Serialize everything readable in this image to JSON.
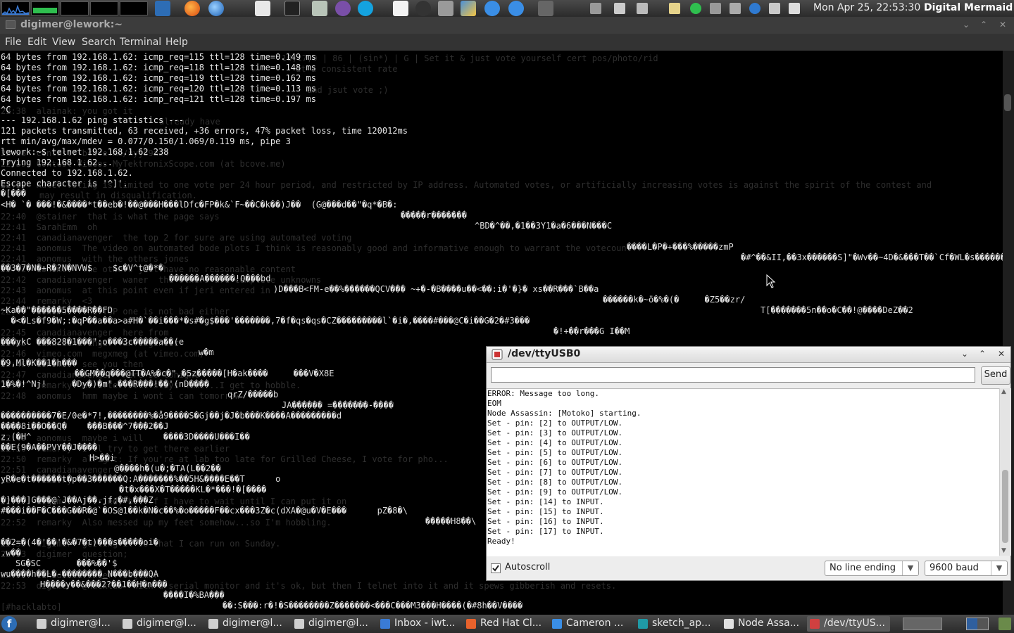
{
  "top_panel": {
    "clock": "Mon Apr 25, 22:53:30",
    "host": "Digital Mermaid"
  },
  "terminal": {
    "title": "digimer@lework:~",
    "menu": [
      "File",
      "Edit",
      "View",
      "Search",
      "Terminal",
      "Help"
    ],
    "lines": [
      "64 bytes from 192.168.1.62: icmp_req=115 ttl=128 time=0.149 ms",
      "64 bytes from 192.168.1.62: icmp_req=118 ttl=128 time=0.148 ms",
      "64 bytes from 192.168.1.62: icmp_req=119 ttl=128 time=0.162 ms",
      "64 bytes from 192.168.1.62: icmp_req=120 ttl=128 time=0.113 ms",
      "64 bytes from 192.168.1.62: icmp_req=121 ttl=128 time=0.197 ms",
      "^C",
      "--- 192.168.1.62 ping statistics ---",
      "121 packets transmitted, 63 received, +36 errors, 47% packet loss, time 120012ms",
      "rtt min/avg/max/mdev = 0.077/0.150/1.069/0.119 ms, pipe 3",
      "lework:~$ telnet 192.168.1.62 238",
      "Trying 192.168.1.62...",
      "Connected to 192.168.1.62.",
      "Escape character is '^]'."
    ],
    "garbage": [
      "�[���",
      "<H� `� ���!�&����*t��eb�!��@���H���lDfc�FP�k&`F~��C�k��)J��  (G@���d��\"�q*�B�:",
      "�����r�������",
      "^BD�^��,�1��3Y1�a�6���N���C",
      "����L�P�+���%�����zmP",
      "�#^��&II,��3x������S]\"�Wv��~4D�&���T��`Cf�WL�s������",
      "��3�7�N�+R�?N�NVW$    $c�V^t@�*�",
      "������A������!Q���bd",
      ")D���B<FM-e��%������QCV��� ~+�-�B����u��<��:i�'�}� xs��R���`B��a",
      "������k�~ö�%�(�     �Z5��zr/",
      "T[�������5n��o�C��!@����DeZ��2",
      "~Ka��\"������5����R��FD",
      "  �<�Ls�f9�W;:�qP��a��a>a#H�`��i���*�s#�g$���'�������,7�f�qs�qs�CZ���������l`�i�,����#���@C�i��G�2�#3���",
      "�!+��r���G I��M",
      "���ykC ���828�1���\":o���3c�����a��(e",
      "w�m",
      "�9,Ml�K��1�h���",
      "��GM��q���@TT�A%�c�\",�5z�����[H�ak����     ���V�X8E",
      "1�%�!^Nj!     �Dy�)�m\".���R���!��'(nD����",
      "qrZ/�����b",
      "JA������ =�������-����",
      "����������7�E/0e�*7!,��������%�å9����S�Gj��j�J�b���K����A���������d",
      "����8i��O��Q�    ���B���^7���2��J",
      "z.(�H^",
      "����3D����U���I��",
      "��E(9�A��PVY��J����",
      "H>��i",
      "@����h�(u�;�TA(L��2��",
      "yR�e�t������t�p��3������Q:A�������%��5H&����E��T      o",
      "�t�x���X�T�����KL�*���!�[����",
      "�]���]G���@`J��Aj��.jf;�#,���Z",
      "#���i��F�C���G��R�@`�OS@1��k�N�c��%�o�����F��cx���3Z�c(dXA�@u�V�E���      pZ�8�\\",
      "�����H8��\\",
      "��2=�(4�'��'�&�7�t)���s�����oi�",
      ".w��",
      "SG�SC       ���%��'$",
      "wu����h��L�-��������_N���b���QA",
      "H����y��&���2?��1��H�n���",
      "����I�%BA���",
      "��:S���:r�!�S��������Z�������<���C���M3���H����(�#8h��V����"
    ],
    "ghost_lines": [
      "10,17,9 | 86 | (sin*) | G | Set it & just vote yourself cert pos/photo/rid",
      "at a consistent rate",
      "and jsut vote ;)",
      "22:38  alainak: you got it",
      "already have",
      "22:38  contest: bcove.me/nyj89az4",
      "22:39  Contest Videos MyTektronixScope.com (at bcove.me)",
      "22:39  Rule: Voting is limited to one vote per 24 hour period, and restricted by IP address. Automated votes, or artificially increasing votes is against the spirit of the contest and",
      "may result in disqualification.",
      "22:40  @stainer  that is what the page says",
      "22:41  SarahEmm  oh",
      "22:41  canadianavenger  the top 2 for sure are using automated voting",
      "22:41  aonomus  The video on automated bode plots I think is reasonably good and informative enough to warrant the votecount",
      "22:41  aonomus  with the others jones",
      "22:42  aonomus  the others just have no reasonable content",
      "22:42  canadianavenger  waner  the others are complete unknowns",
      "22:43  aonomus  at this point even if jeri entered in",
      "22:44  remarky  <3",
      "22:44  aonomus  the TOP one is not bad either",
      "22:45  canadianavenger  here from",
      "22:45  canadianavenger  an engineer",
      "22:46  vimeo.com  megxmeg (at vimeo.com)",
      "22:46  aonomus  see you then",
      "22:47  canadianavenger  here so tonight",
      "22:47  remarky  me after bike stays home...I get to hobble.",
      "22:48  aonomus  hmm maybe i wont i can tomorrow",
      "22:49  aonomus  maybe i will",
      "22:50  remarky  I'll try to get there earlier",
      "22:50  remarky  alright: If you're at lab too late for Grilled Cheese, I vote for pho...",
      "22:51  canadianavenger  o",
      "22:52  remarky  ok",
      "22:52  digimer  I tried, but if I have to wait until I can put it on",
      "22:52  remarky  Also messed up my feet somehow...so I'm hobbling.",
      "22:53  digimer  getting it so that I can run on Sunday.",
      "22:53  digimer  question;",
      "22:53  canadianavenger  digimer",
      "22:53  digimer  @hacklab  with a serial monitor and it's ok, but then I telnet into it and it spews gibberish and resets.",
      "[#hacklabto]"
    ]
  },
  "serial_monitor": {
    "title": "/dev/ttyUSB0",
    "input_value": "",
    "send_label": "Send",
    "output": [
      "ERROR: Message too long.",
      "EOM",
      "Node Assassin: [Motoko] starting.",
      "Set - pin: [2] to OUTPUT/LOW.",
      "Set - pin: [3] to OUTPUT/LOW.",
      "Set - pin: [4] to OUTPUT/LOW.",
      "Set - pin: [5] to OUTPUT/LOW.",
      "Set - pin: [6] to OUTPUT/LOW.",
      "Set - pin: [7] to OUTPUT/LOW.",
      "Set - pin: [8] to OUTPUT/LOW.",
      "Set - pin: [9] to OUTPUT/LOW.",
      "Set - pin: [14] to INPUT.",
      "Set - pin: [15] to INPUT.",
      "Set - pin: [16] to INPUT.",
      "Set - pin: [17] to INPUT.",
      "Ready!"
    ],
    "autoscroll_label": "Autoscroll",
    "autoscroll_checked": true,
    "line_ending": "No line ending",
    "baud": "9600 baud"
  },
  "taskbar": {
    "tasks": [
      {
        "label": "digimer@l...",
        "icon": "terminal-icon",
        "color": "#cfcfcf",
        "active": false
      },
      {
        "label": "digimer@l...",
        "icon": "terminal-icon",
        "color": "#cfcfcf",
        "active": false
      },
      {
        "label": "digimer@l...",
        "icon": "terminal-icon",
        "color": "#cfcfcf",
        "active": false
      },
      {
        "label": "digimer@l...",
        "icon": "terminal-icon",
        "color": "#cfcfcf",
        "active": false
      },
      {
        "label": "Inbox - iwt...",
        "icon": "mail-client-icon",
        "color": "#3a7bd5",
        "active": false
      },
      {
        "label": "Red Hat Cl...",
        "icon": "firefox-icon",
        "color": "#e8622c",
        "active": false
      },
      {
        "label": "Cameron ...",
        "icon": "chat-client-icon",
        "color": "#3a8ee6",
        "active": false
      },
      {
        "label": "sketch_ap...",
        "icon": "arduino-icon",
        "color": "#1f9aa6",
        "active": false
      },
      {
        "label": "Node Assa...",
        "icon": "text-editor-icon",
        "color": "#e0e0e0",
        "active": false
      },
      {
        "label": "/dev/ttyUS...",
        "icon": "arduino-serial-icon",
        "color": "#d04040",
        "active": true
      }
    ]
  }
}
